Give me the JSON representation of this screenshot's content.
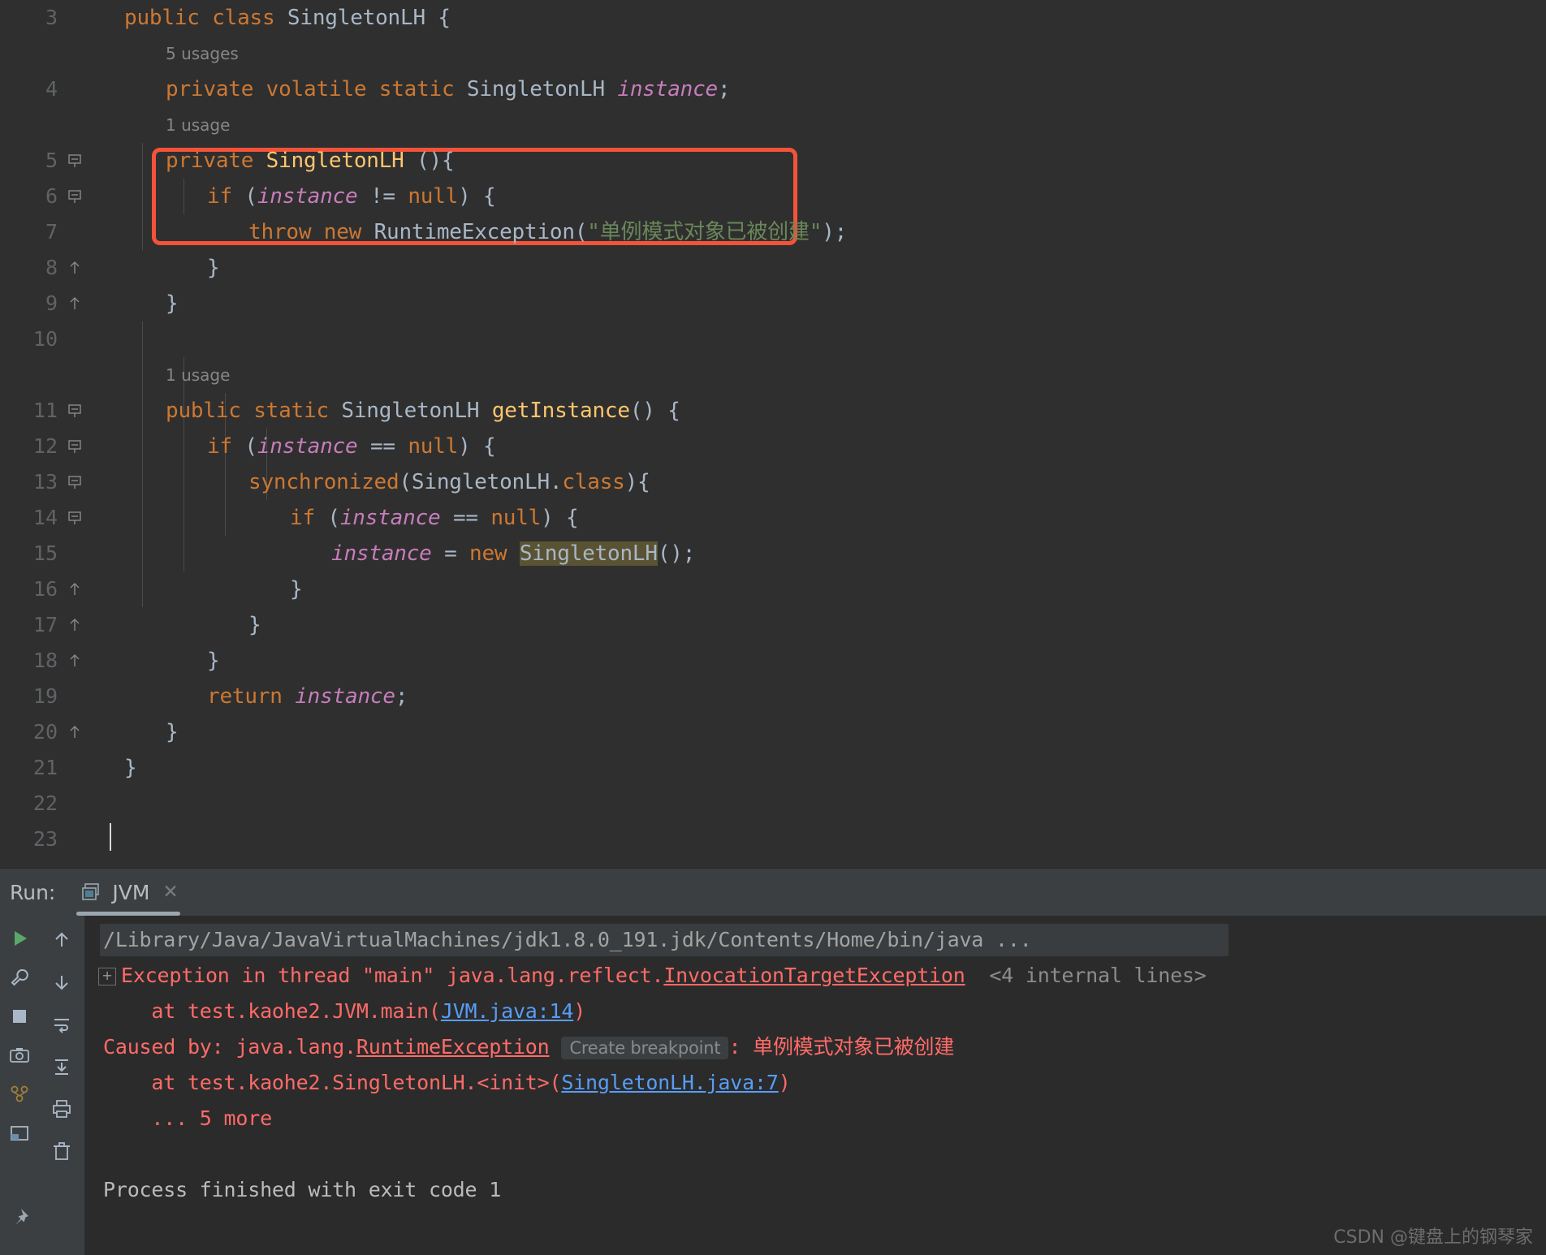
{
  "editor": {
    "lines": [
      {
        "num": "3",
        "indent": 0,
        "fold": "none",
        "hint": "",
        "segments": [
          {
            "t": "public ",
            "c": "kw"
          },
          {
            "t": "class ",
            "c": "kw"
          },
          {
            "t": "SingletonLH",
            "c": "typ"
          },
          {
            "t": " {",
            "c": "pl"
          }
        ]
      },
      {
        "num": "4",
        "indent": 1,
        "fold": "none",
        "hint": "5 usages",
        "segments": [
          {
            "t": "private ",
            "c": "kw"
          },
          {
            "t": "volatile ",
            "c": "kw"
          },
          {
            "t": "static ",
            "c": "kw"
          },
          {
            "t": "SingletonLH ",
            "c": "typ"
          },
          {
            "t": "instance",
            "c": "fld"
          },
          {
            "t": ";",
            "c": "pl"
          }
        ]
      },
      {
        "num": "5",
        "indent": 1,
        "fold": "start",
        "hint": "1 usage",
        "segments": [
          {
            "t": "private ",
            "c": "kw"
          },
          {
            "t": "SingletonLH",
            "c": "fn"
          },
          {
            "t": " (){",
            "c": "pl"
          }
        ]
      },
      {
        "num": "6",
        "indent": 2,
        "fold": "start",
        "hint": "",
        "segments": [
          {
            "t": "if ",
            "c": "kw"
          },
          {
            "t": "(",
            "c": "pl"
          },
          {
            "t": "instance",
            "c": "fld"
          },
          {
            "t": " != ",
            "c": "pl"
          },
          {
            "t": "null",
            "c": "kw"
          },
          {
            "t": ") {",
            "c": "pl"
          }
        ]
      },
      {
        "num": "7",
        "indent": 3,
        "fold": "none",
        "hint": "",
        "segments": [
          {
            "t": "throw ",
            "c": "kw"
          },
          {
            "t": "new ",
            "c": "kw"
          },
          {
            "t": "RuntimeException",
            "c": "typ"
          },
          {
            "t": "(",
            "c": "pl"
          },
          {
            "t": "\"单例模式对象已被创建\"",
            "c": "str"
          },
          {
            "t": ");",
            "c": "pl"
          }
        ]
      },
      {
        "num": "8",
        "indent": 2,
        "fold": "end",
        "hint": "",
        "segments": [
          {
            "t": "}",
            "c": "pl"
          }
        ]
      },
      {
        "num": "9",
        "indent": 1,
        "fold": "end",
        "hint": "",
        "segments": [
          {
            "t": "}",
            "c": "pl"
          }
        ]
      },
      {
        "num": "10",
        "indent": 0,
        "fold": "none",
        "hint": "",
        "segments": []
      },
      {
        "num": "11",
        "indent": 1,
        "fold": "start",
        "hint": "1 usage",
        "segments": [
          {
            "t": "public ",
            "c": "kw"
          },
          {
            "t": "static ",
            "c": "kw"
          },
          {
            "t": "SingletonLH ",
            "c": "typ"
          },
          {
            "t": "getInstance",
            "c": "fn"
          },
          {
            "t": "() {",
            "c": "pl"
          }
        ]
      },
      {
        "num": "12",
        "indent": 2,
        "fold": "start",
        "hint": "",
        "segments": [
          {
            "t": "if ",
            "c": "kw"
          },
          {
            "t": "(",
            "c": "pl"
          },
          {
            "t": "instance",
            "c": "fld"
          },
          {
            "t": " == ",
            "c": "pl"
          },
          {
            "t": "null",
            "c": "kw"
          },
          {
            "t": ") {",
            "c": "pl"
          }
        ]
      },
      {
        "num": "13",
        "indent": 3,
        "fold": "start",
        "hint": "",
        "segments": [
          {
            "t": "synchronized",
            "c": "kw"
          },
          {
            "t": "(SingletonLH.",
            "c": "typ"
          },
          {
            "t": "class",
            "c": "kw"
          },
          {
            "t": "){",
            "c": "pl"
          }
        ]
      },
      {
        "num": "14",
        "indent": 4,
        "fold": "start",
        "hint": "",
        "segments": [
          {
            "t": "if ",
            "c": "kw"
          },
          {
            "t": "(",
            "c": "pl"
          },
          {
            "t": "instance",
            "c": "fld"
          },
          {
            "t": " == ",
            "c": "pl"
          },
          {
            "t": "null",
            "c": "kw"
          },
          {
            "t": ") {",
            "c": "pl"
          }
        ]
      },
      {
        "num": "15",
        "indent": 5,
        "fold": "none",
        "hint": "",
        "segments": [
          {
            "t": "instance",
            "c": "fld"
          },
          {
            "t": " = ",
            "c": "pl"
          },
          {
            "t": "new ",
            "c": "kw"
          },
          {
            "t": "SingletonLH",
            "c": "hl-ident"
          },
          {
            "t": "();",
            "c": "pl"
          }
        ]
      },
      {
        "num": "16",
        "indent": 4,
        "fold": "end",
        "hint": "",
        "segments": [
          {
            "t": "}",
            "c": "pl"
          }
        ]
      },
      {
        "num": "17",
        "indent": 3,
        "fold": "end",
        "hint": "",
        "segments": [
          {
            "t": "}",
            "c": "pl"
          }
        ]
      },
      {
        "num": "18",
        "indent": 2,
        "fold": "end",
        "hint": "",
        "segments": [
          {
            "t": "}",
            "c": "pl"
          }
        ]
      },
      {
        "num": "19",
        "indent": 2,
        "fold": "none",
        "hint": "",
        "segments": [
          {
            "t": "return ",
            "c": "kw"
          },
          {
            "t": "instance",
            "c": "fld"
          },
          {
            "t": ";",
            "c": "pl"
          }
        ]
      },
      {
        "num": "20",
        "indent": 1,
        "fold": "end",
        "hint": "",
        "segments": [
          {
            "t": "}",
            "c": "pl"
          }
        ]
      },
      {
        "num": "21",
        "indent": 0,
        "fold": "none",
        "hint": "",
        "segments": [
          {
            "t": "}",
            "c": "pl"
          }
        ]
      },
      {
        "num": "22",
        "indent": 0,
        "fold": "none",
        "hint": "",
        "segments": []
      },
      {
        "num": "23",
        "indent": 0,
        "fold": "none",
        "hint": "",
        "segments": []
      }
    ],
    "annotation_box": {
      "color": "#f4533a"
    },
    "highlight_color": "#5a5333"
  },
  "run_panel": {
    "label": "Run:",
    "tab_name": "JVM",
    "close_glyph": "✕",
    "toolbar_left": [
      {
        "name": "rerun-button",
        "glyph": "▶"
      },
      {
        "name": "settings-wrench-button",
        "glyph": "wrench"
      },
      {
        "name": "stop-button",
        "glyph": "■"
      },
      {
        "name": "screenshot-button",
        "glyph": "camera"
      },
      {
        "name": "thread-dump-button",
        "glyph": "threads"
      },
      {
        "name": "layout-button",
        "glyph": "layout"
      },
      {
        "name": "pin-button",
        "glyph": "pin"
      }
    ],
    "toolbar_right": [
      {
        "name": "up-stacktrace-button",
        "glyph": "↑"
      },
      {
        "name": "down-stacktrace-button",
        "glyph": "↓"
      },
      {
        "name": "soft-wrap-button",
        "glyph": "wrap"
      },
      {
        "name": "scroll-to-end-button",
        "glyph": "scrollend"
      },
      {
        "name": "print-button",
        "glyph": "printer"
      },
      {
        "name": "clear-all-button",
        "glyph": "trash"
      }
    ]
  },
  "console": {
    "lines": [
      {
        "type": "cmd",
        "text": "/Library/Java/JavaVirtualMachines/jdk1.8.0_191.jdk/Contents/Home/bin/java ..."
      },
      {
        "type": "exception_head",
        "expander": "⊞",
        "prefix": "Exception in thread \"main\" java.lang.reflect.",
        "link": "InvocationTargetException",
        "suffix": "<4 internal lines>"
      },
      {
        "type": "at",
        "prefix": "    at test.kaohe2.JVM.main(",
        "link": "JVM.java:14",
        "suffix": ")"
      },
      {
        "type": "caused",
        "prefix": "Caused by: java.lang.",
        "ulink": "RuntimeException",
        "chip": "Create breakpoint",
        "suffix": ": 单例模式对象已被创建"
      },
      {
        "type": "at",
        "prefix": "    at test.kaohe2.SingletonLH.<init>(",
        "link": "SingletonLH.java:7",
        "suffix": ")"
      },
      {
        "type": "more",
        "text": "    ... 5 more"
      },
      {
        "type": "blank",
        "text": ""
      },
      {
        "type": "out",
        "text": "Process finished with exit code 1"
      }
    ]
  },
  "watermark": "CSDN @键盘上的钢琴家"
}
